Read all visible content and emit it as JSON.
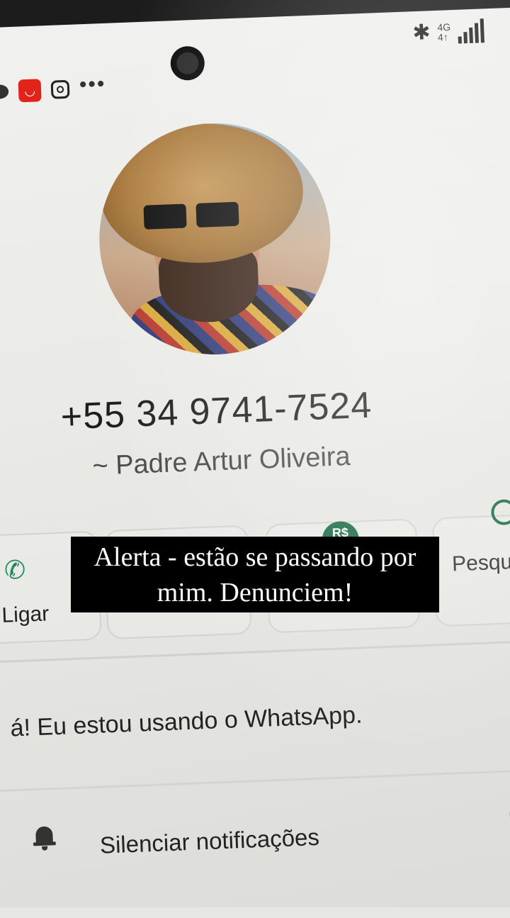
{
  "status_bar": {
    "network": "4G",
    "network_sub": "4↑",
    "app_icons": [
      "chat-icon",
      "aliexpress-icon",
      "instagram-icon",
      "more-icon"
    ],
    "dots": "•••"
  },
  "contact": {
    "phone_number": "+55 34 9741-7524",
    "name": "~ Padre Artur Oliveira",
    "about": "á! Eu estou usando o WhatsApp."
  },
  "actions": {
    "call_label": "Ligar",
    "pay_badge": "R$",
    "search_label": "Pesqu"
  },
  "settings": {
    "mute_label": "Silenciar notificações"
  },
  "overlay": {
    "caption": "Alerta - estão se passando por mim. Denunciem!"
  },
  "colors": {
    "accent_green": "#1a6a45",
    "caption_bg": "#000000",
    "caption_text": "#ffffff"
  }
}
